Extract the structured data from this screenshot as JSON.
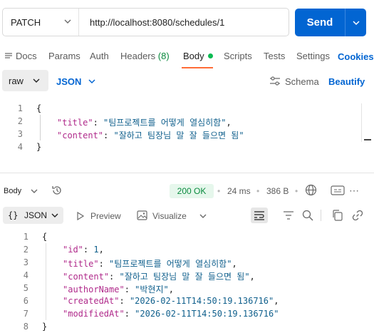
{
  "request": {
    "method": "PATCH",
    "url": "http://localhost:8080/schedules/1",
    "send_label": "Send"
  },
  "tabs": {
    "docs": "Docs",
    "params": "Params",
    "auth": "Auth",
    "headers": "Headers",
    "headers_count": "(8)",
    "body": "Body",
    "scripts": "Scripts",
    "tests": "Tests",
    "settings": "Settings",
    "cookies": "Cookies"
  },
  "body_options": {
    "mode": "raw",
    "language": "JSON",
    "schema": "Schema",
    "beautify": "Beautify"
  },
  "request_body": {
    "line_numbers": [
      "1",
      "2",
      "3",
      "4"
    ],
    "open": "{",
    "close": "}",
    "title_key": "\"title\"",
    "title_value": "\"팀프로젝트를 어떻게 열심히함\"",
    "content_key": "\"content\"",
    "content_value": "\"잘하고 팀장님 말 잘 들으면 됨\""
  },
  "response": {
    "section_label": "Body",
    "status": "200 OK",
    "time": "24 ms",
    "size": "386 B",
    "format_label": "JSON",
    "preview_label": "Preview",
    "visualize_label": "Visualize",
    "line_numbers": [
      "1",
      "2",
      "3",
      "4",
      "5",
      "6",
      "7",
      "8"
    ],
    "open": "{",
    "close": "}",
    "id_key": "\"id\"",
    "id_value": "1",
    "title_key": "\"title\"",
    "title_value": "\"팀프로젝트를 어떻게 열심히함\"",
    "content_key": "\"content\"",
    "content_value": "\"잘하고 팀장님 말 잘 들으면 됨\"",
    "author_key": "\"authorName\"",
    "author_value": "\"박현지\"",
    "created_key": "\"createdAt\"",
    "created_value": "\"2026-02-11T14:50:19.136716\"",
    "modified_key": "\"modifiedAt\"",
    "modified_value": "\"2026-02-11T14:50:19.136716\""
  },
  "colors": {
    "accent": "#0265d2",
    "active_tab": "#ff6c37",
    "status_ok": "#0a8a3e",
    "json_key": "#b02a8b",
    "json_value": "#0f5f8c"
  }
}
